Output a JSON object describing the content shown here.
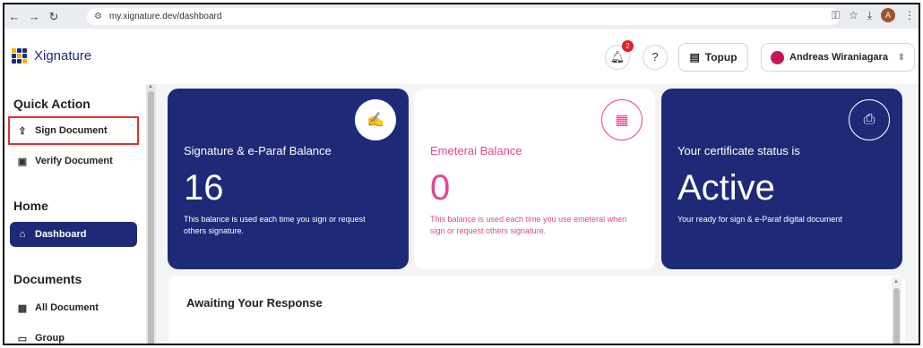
{
  "browser": {
    "back": "←",
    "forward": "→",
    "reload": "↻",
    "url": "my.xignature.dev/dashboard",
    "profile_initial": "A"
  },
  "header": {
    "logo_text": "Xignature",
    "notification_count": "2",
    "topup_label": "Topup",
    "user_name": "Andreas Wiraniagara"
  },
  "sidebar": {
    "quick_action_title": "Quick Action",
    "quick_actions": [
      {
        "label": "Sign Document",
        "icon": "upload-icon"
      },
      {
        "label": "Verify Document",
        "icon": "document-icon"
      }
    ],
    "home_title": "Home",
    "home_items": [
      {
        "label": "Dashboard",
        "icon": "home-icon"
      }
    ],
    "documents_title": "Documents",
    "document_items": [
      {
        "label": "All Document",
        "icon": "file-icon"
      },
      {
        "label": "Group",
        "icon": "folder-icon"
      }
    ]
  },
  "cards": {
    "signature": {
      "title": "Signature & e-Paraf Balance",
      "value": "16",
      "desc": "This balance is used each time you sign or request others signature."
    },
    "emeterai": {
      "title": "Emeterai Balance",
      "value": "0",
      "desc": "This balance is used each time you use emeteral when sign or request others signature."
    },
    "certificate": {
      "title": "Your certificate status is",
      "value": "Active",
      "desc": "Your ready for sign & e-Paraf digital document"
    }
  },
  "awaiting": {
    "title": "Awaiting Your Response"
  },
  "colors": {
    "brand_blue": "#1e2a78",
    "accent_pink": "#e4468f",
    "highlight_red": "#e03131"
  }
}
